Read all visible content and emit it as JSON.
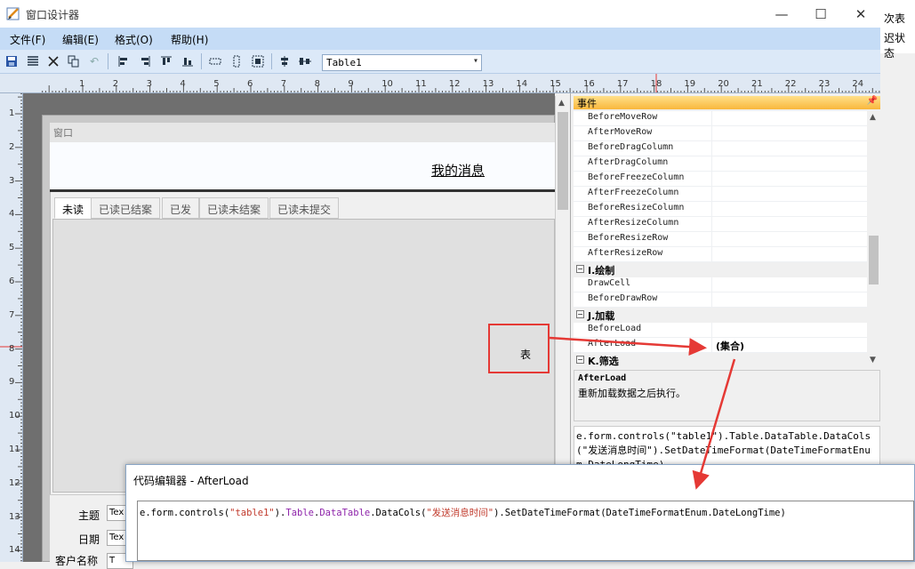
{
  "background_app": {
    "text1": "次表",
    "text2": "迟状态"
  },
  "window": {
    "title": "窗口设计器",
    "minimize": "—",
    "maximize": "☐",
    "close": "✕"
  },
  "menu": [
    "文件(F)",
    "编辑(E)",
    "格式(O)",
    "帮助(H)"
  ],
  "toolbar": {
    "icons": [
      "save-icon",
      "properties-icon",
      "delete-icon",
      "copy-icon",
      "undo-icon",
      "align-left-icon",
      "align-right-icon",
      "align-top-icon",
      "align-bottom-icon",
      "same-width-icon",
      "same-height-icon",
      "same-size-icon",
      "center-vertical-icon",
      "center-horizontal-icon"
    ],
    "control_select_value": "Table1"
  },
  "ruler": {
    "h_numbers": [
      "1",
      "2",
      "3",
      "4",
      "5",
      "6",
      "7",
      "8",
      "9",
      "10",
      "11",
      "12",
      "13",
      "14",
      "15",
      "16",
      "17",
      "18",
      "19",
      "20",
      "21",
      "22",
      "23",
      "24"
    ],
    "v_numbers": [
      "1",
      "2",
      "3",
      "4",
      "5",
      "6",
      "7",
      "8",
      "9",
      "10",
      "11",
      "12",
      "13",
      "14"
    ]
  },
  "form": {
    "caption": "窗口",
    "header_title": "我的消息",
    "tabs": [
      "未读",
      "已读已结案",
      "已发",
      "已读未结案",
      "已读未提交"
    ],
    "active_tab": 0,
    "table_label": "表",
    "fields": [
      {
        "label": "主题",
        "value": "Tex"
      },
      {
        "label": "日期",
        "value": "Tex"
      },
      {
        "label": "客户名称",
        "value": "T"
      }
    ]
  },
  "properties": {
    "header": "事件",
    "rows": [
      {
        "kind": "item",
        "name": "BeforeMoveRow",
        "value": ""
      },
      {
        "kind": "item",
        "name": "AfterMoveRow",
        "value": ""
      },
      {
        "kind": "item",
        "name": "BeforeDragColumn",
        "value": ""
      },
      {
        "kind": "item",
        "name": "AfterDragColumn",
        "value": ""
      },
      {
        "kind": "item",
        "name": "BeforeFreezeColumn",
        "value": ""
      },
      {
        "kind": "item",
        "name": "AfterFreezeColumn",
        "value": ""
      },
      {
        "kind": "item",
        "name": "BeforeResizeColumn",
        "value": ""
      },
      {
        "kind": "item",
        "name": "AfterResizeColumn",
        "value": ""
      },
      {
        "kind": "item",
        "name": "BeforeResizeRow",
        "value": ""
      },
      {
        "kind": "item",
        "name": "AfterResizeRow",
        "value": ""
      },
      {
        "kind": "category",
        "name": "I.绘制",
        "value": ""
      },
      {
        "kind": "item",
        "name": "DrawCell",
        "value": ""
      },
      {
        "kind": "item",
        "name": "BeforeDrawRow",
        "value": ""
      },
      {
        "kind": "category",
        "name": "J.加载",
        "value": ""
      },
      {
        "kind": "item",
        "name": "BeforeLoad",
        "value": ""
      },
      {
        "kind": "item",
        "name": "AfterLoad",
        "value": "(集合)"
      },
      {
        "kind": "category",
        "name": "K.筛选",
        "value": ""
      }
    ],
    "description_name": "AfterLoad",
    "description_text": "重新加载数据之后执行。",
    "code_preview": "e.form.controls(\"table1\").Table.DataTable.DataCols(\"发送消息时间\").SetDateTimeFormat(DateTimeFormatEnum.DateLongTime)"
  },
  "code_editor": {
    "title": "代码编辑器 - AfterLoad",
    "code": {
      "p1": "e.form.controls(",
      "s1": "\"table1\"",
      "p2": ").",
      "m1": "Table",
      "p3": ".",
      "m2": "DataTable",
      "p4": ".DataCols(",
      "s2": "\"发送消息时间\"",
      "p5": ").SetDateTimeFormat(DateTimeFormatEnum.DateLongTime)"
    }
  },
  "colors": {
    "annotation_red": "#e53935",
    "menubar": "#c5dcf6",
    "prop_header": "#f9b73c"
  }
}
